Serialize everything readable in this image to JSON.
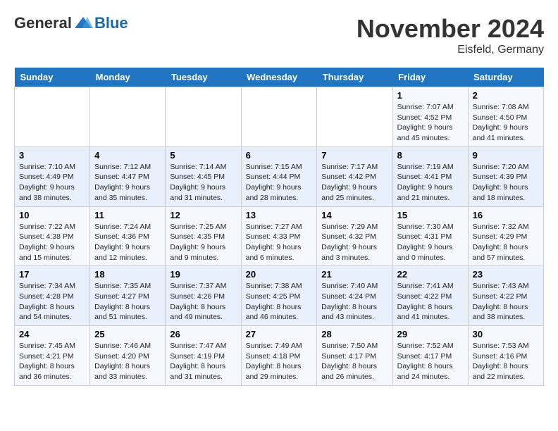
{
  "logo": {
    "general": "General",
    "blue": "Blue"
  },
  "title": "November 2024",
  "location": "Eisfeld, Germany",
  "days_of_week": [
    "Sunday",
    "Monday",
    "Tuesday",
    "Wednesday",
    "Thursday",
    "Friday",
    "Saturday"
  ],
  "weeks": [
    [
      {
        "day": "",
        "info": ""
      },
      {
        "day": "",
        "info": ""
      },
      {
        "day": "",
        "info": ""
      },
      {
        "day": "",
        "info": ""
      },
      {
        "day": "",
        "info": ""
      },
      {
        "day": "1",
        "info": "Sunrise: 7:07 AM\nSunset: 4:52 PM\nDaylight: 9 hours and 45 minutes."
      },
      {
        "day": "2",
        "info": "Sunrise: 7:08 AM\nSunset: 4:50 PM\nDaylight: 9 hours and 41 minutes."
      }
    ],
    [
      {
        "day": "3",
        "info": "Sunrise: 7:10 AM\nSunset: 4:49 PM\nDaylight: 9 hours and 38 minutes."
      },
      {
        "day": "4",
        "info": "Sunrise: 7:12 AM\nSunset: 4:47 PM\nDaylight: 9 hours and 35 minutes."
      },
      {
        "day": "5",
        "info": "Sunrise: 7:14 AM\nSunset: 4:45 PM\nDaylight: 9 hours and 31 minutes."
      },
      {
        "day": "6",
        "info": "Sunrise: 7:15 AM\nSunset: 4:44 PM\nDaylight: 9 hours and 28 minutes."
      },
      {
        "day": "7",
        "info": "Sunrise: 7:17 AM\nSunset: 4:42 PM\nDaylight: 9 hours and 25 minutes."
      },
      {
        "day": "8",
        "info": "Sunrise: 7:19 AM\nSunset: 4:41 PM\nDaylight: 9 hours and 21 minutes."
      },
      {
        "day": "9",
        "info": "Sunrise: 7:20 AM\nSunset: 4:39 PM\nDaylight: 9 hours and 18 minutes."
      }
    ],
    [
      {
        "day": "10",
        "info": "Sunrise: 7:22 AM\nSunset: 4:38 PM\nDaylight: 9 hours and 15 minutes."
      },
      {
        "day": "11",
        "info": "Sunrise: 7:24 AM\nSunset: 4:36 PM\nDaylight: 9 hours and 12 minutes."
      },
      {
        "day": "12",
        "info": "Sunrise: 7:25 AM\nSunset: 4:35 PM\nDaylight: 9 hours and 9 minutes."
      },
      {
        "day": "13",
        "info": "Sunrise: 7:27 AM\nSunset: 4:33 PM\nDaylight: 9 hours and 6 minutes."
      },
      {
        "day": "14",
        "info": "Sunrise: 7:29 AM\nSunset: 4:32 PM\nDaylight: 9 hours and 3 minutes."
      },
      {
        "day": "15",
        "info": "Sunrise: 7:30 AM\nSunset: 4:31 PM\nDaylight: 9 hours and 0 minutes."
      },
      {
        "day": "16",
        "info": "Sunrise: 7:32 AM\nSunset: 4:29 PM\nDaylight: 8 hours and 57 minutes."
      }
    ],
    [
      {
        "day": "17",
        "info": "Sunrise: 7:34 AM\nSunset: 4:28 PM\nDaylight: 8 hours and 54 minutes."
      },
      {
        "day": "18",
        "info": "Sunrise: 7:35 AM\nSunset: 4:27 PM\nDaylight: 8 hours and 51 minutes."
      },
      {
        "day": "19",
        "info": "Sunrise: 7:37 AM\nSunset: 4:26 PM\nDaylight: 8 hours and 49 minutes."
      },
      {
        "day": "20",
        "info": "Sunrise: 7:38 AM\nSunset: 4:25 PM\nDaylight: 8 hours and 46 minutes."
      },
      {
        "day": "21",
        "info": "Sunrise: 7:40 AM\nSunset: 4:24 PM\nDaylight: 8 hours and 43 minutes."
      },
      {
        "day": "22",
        "info": "Sunrise: 7:41 AM\nSunset: 4:22 PM\nDaylight: 8 hours and 41 minutes."
      },
      {
        "day": "23",
        "info": "Sunrise: 7:43 AM\nSunset: 4:22 PM\nDaylight: 8 hours and 38 minutes."
      }
    ],
    [
      {
        "day": "24",
        "info": "Sunrise: 7:45 AM\nSunset: 4:21 PM\nDaylight: 8 hours and 36 minutes."
      },
      {
        "day": "25",
        "info": "Sunrise: 7:46 AM\nSunset: 4:20 PM\nDaylight: 8 hours and 33 minutes."
      },
      {
        "day": "26",
        "info": "Sunrise: 7:47 AM\nSunset: 4:19 PM\nDaylight: 8 hours and 31 minutes."
      },
      {
        "day": "27",
        "info": "Sunrise: 7:49 AM\nSunset: 4:18 PM\nDaylight: 8 hours and 29 minutes."
      },
      {
        "day": "28",
        "info": "Sunrise: 7:50 AM\nSunset: 4:17 PM\nDaylight: 8 hours and 26 minutes."
      },
      {
        "day": "29",
        "info": "Sunrise: 7:52 AM\nSunset: 4:17 PM\nDaylight: 8 hours and 24 minutes."
      },
      {
        "day": "30",
        "info": "Sunrise: 7:53 AM\nSunset: 4:16 PM\nDaylight: 8 hours and 22 minutes."
      }
    ]
  ]
}
